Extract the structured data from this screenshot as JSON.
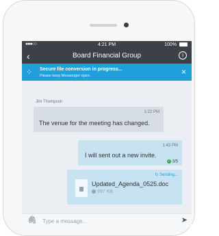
{
  "status": {
    "signal": "●●●○○",
    "time": "4:21 PM",
    "battery": "100%"
  },
  "nav": {
    "back": "‹",
    "title": "Board Financial Group",
    "info": "i"
  },
  "banner": {
    "spinner": "⁘",
    "title": "Secure file conversion in progress...",
    "subtitle": "Please keep Messenger open.",
    "close": "×"
  },
  "messages": {
    "incoming": {
      "sender": "Jim Thompson",
      "time": "1:22 PM",
      "text": "The venue for the meeting has changed."
    },
    "outgoing": {
      "time": "1:43 PM",
      "text": "I will sent out a new invite.",
      "read_check": "✓",
      "read": "3/5"
    },
    "attachment": {
      "status": "↻ Sending...",
      "name": "Updated_Agenda_0525.doc",
      "size": "697 KB"
    }
  },
  "composer": {
    "attach_icon": "🖇",
    "placeholder": "Type a message...",
    "send_icon": "➤"
  },
  "colors": {
    "navbar": "#3c4148",
    "banner": "#1fa0dd",
    "incoming_bubble": "#d6dde4",
    "outgoing_bubble": "#c7e2f0"
  }
}
